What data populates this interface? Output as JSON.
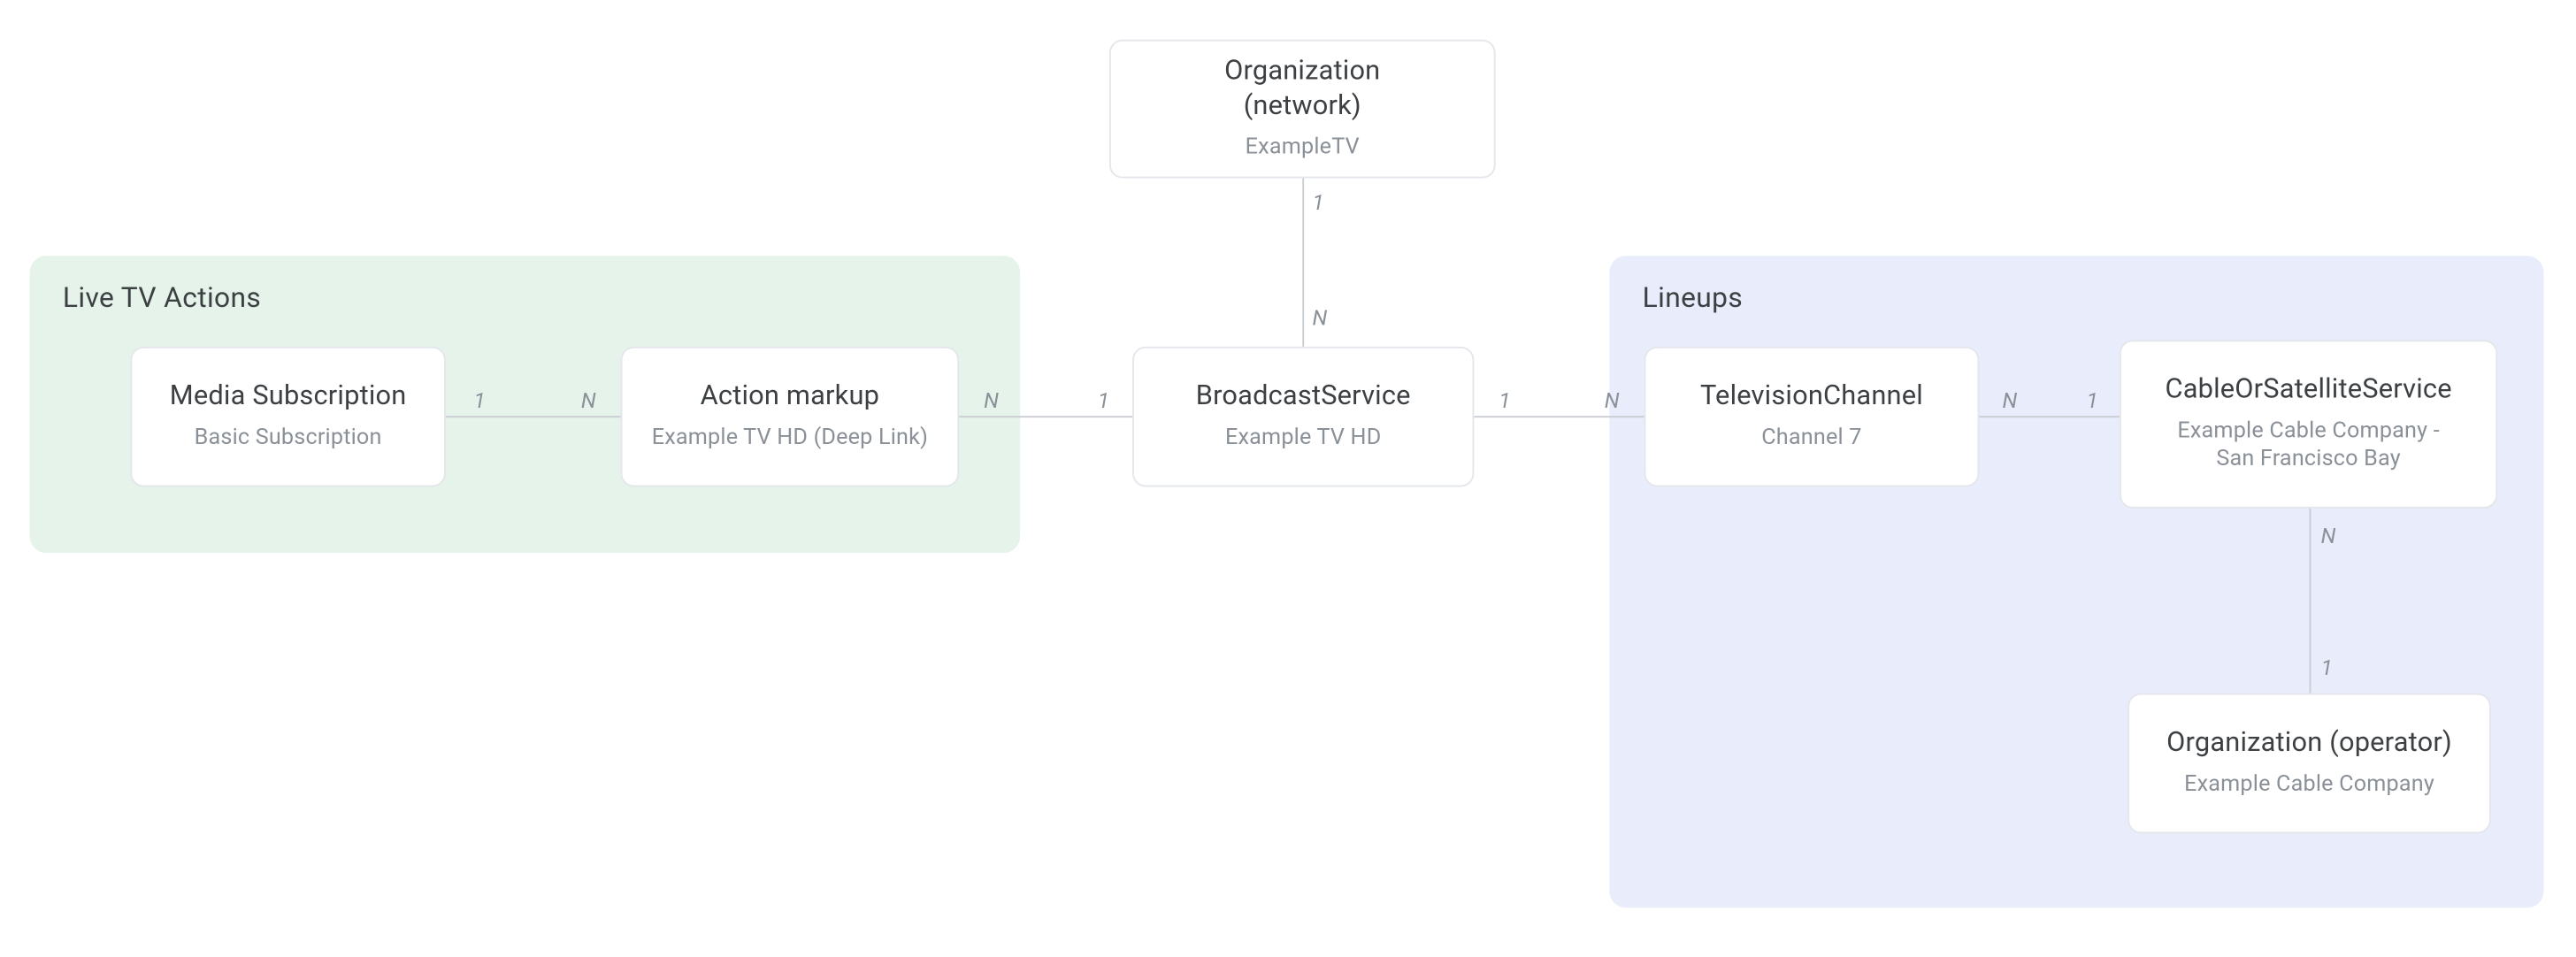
{
  "groups": {
    "live_tv": {
      "title": "Live TV Actions"
    },
    "lineups": {
      "title": "Lineups"
    }
  },
  "nodes": {
    "org_network": {
      "title_l1": "Organization",
      "title_l2": "(network)",
      "sub": "ExampleTV"
    },
    "media_subscription": {
      "title": "Media Subscription",
      "sub": "Basic Subscription"
    },
    "action_markup": {
      "title": "Action markup",
      "sub": "Example TV HD (Deep Link)"
    },
    "broadcast_service": {
      "title": "BroadcastService",
      "sub": "Example TV HD"
    },
    "television_channel": {
      "title": "TelevisionChannel",
      "sub": "Channel 7"
    },
    "cable_service": {
      "title": "CableOrSatelliteService",
      "sub_l1": "Example Cable Company -",
      "sub_l2": "San Francisco Bay"
    },
    "org_operator": {
      "title": "Organization (operator)",
      "sub": "Example Cable Company"
    }
  },
  "cardinalities": {
    "one": "1",
    "many": "N"
  }
}
